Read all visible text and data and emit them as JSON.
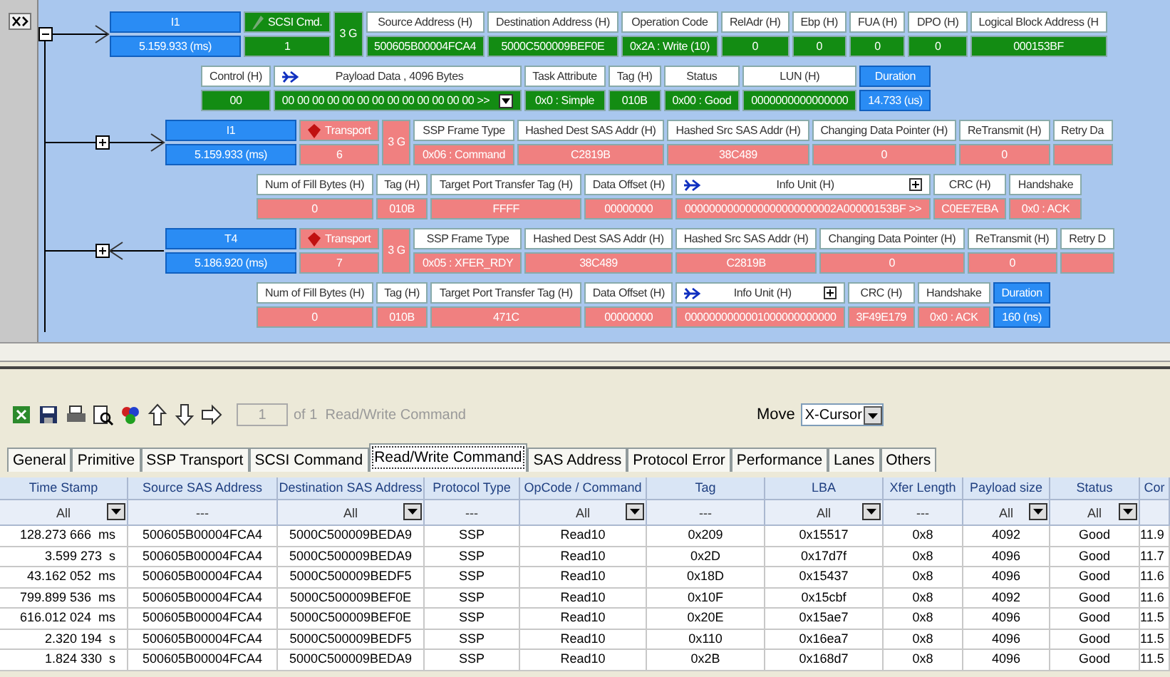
{
  "frames": [
    {
      "kind": "command",
      "color": "#138c13",
      "expanded": true,
      "id": {
        "kind": "initiator",
        "label": "I1",
        "time": "5.159.933 (ms)"
      },
      "type": {
        "label": "SCSI Cmd.",
        "value": "1"
      },
      "speed": "3 G",
      "fields": [
        {
          "label": "Source Address (H)",
          "value": "500605B00004FCA4"
        },
        {
          "label": "Destination Address (H)",
          "value": "5000C500009BEF0E"
        },
        {
          "label": "Operation Code",
          "value": "0x2A : Write (10)"
        },
        {
          "label": "RelAdr (H)",
          "value": "0"
        },
        {
          "label": "Ebp (H)",
          "value": "0"
        },
        {
          "label": "FUA (H)",
          "value": "0"
        },
        {
          "label": "DPO (H)",
          "value": "0"
        },
        {
          "label": "Logical Block Address (H",
          "value": "000153BF"
        }
      ],
      "detail": [
        {
          "kind": "field",
          "label": "Control (H)",
          "value": "00"
        },
        {
          "kind": "payload",
          "label": "Payload Data , 4096 Bytes",
          "value": "00 00 00 00 00 00 00 00 00 00 00 00 00 >>"
        },
        {
          "kind": "field",
          "label": "Task Attribute",
          "value": "0x0 : Simple"
        },
        {
          "kind": "field",
          "label": "Tag (H)",
          "value": "010B"
        },
        {
          "kind": "field",
          "label": "Status",
          "value": "0x00 : Good"
        },
        {
          "kind": "field",
          "label": "LUN (H)",
          "value": "0000000000000000"
        },
        {
          "kind": "duration",
          "label": "Duration",
          "value": "14.733 (us)"
        }
      ],
      "children": [
        {
          "kind": "transport",
          "color": "#f08080",
          "expanded": false,
          "id": {
            "kind": "initiator",
            "label": "I1",
            "time": "5.159.933 (ms)"
          },
          "type": {
            "label": "Transport",
            "value": "6"
          },
          "speed": "3 G",
          "fields": [
            {
              "label": "SSP Frame Type",
              "value": "0x06 : Command"
            },
            {
              "label": "Hashed Dest SAS Addr (H)",
              "value": "C2819B"
            },
            {
              "label": "Hashed Src SAS Addr (H)",
              "value": "38C489"
            },
            {
              "label": "Changing Data Pointer (H)",
              "value": "0"
            },
            {
              "label": "ReTransmit (H)",
              "value": "0"
            },
            {
              "label": "Retry Da"
            }
          ],
          "detail": [
            {
              "kind": "field",
              "label": "Num of Fill Bytes (H)",
              "value": "0"
            },
            {
              "kind": "field",
              "label": "Tag (H)",
              "value": "010B"
            },
            {
              "kind": "field",
              "label": "Target Port Transfer Tag (H)",
              "value": "FFFF"
            },
            {
              "kind": "field",
              "label": "Data Offset (H)",
              "value": "00000000"
            },
            {
              "kind": "info-unit",
              "label": "Info Unit (H)",
              "value": "0000000000000000000000002A00000153BF >>"
            },
            {
              "kind": "field",
              "label": "CRC (H)",
              "value": "C0EE7EBA"
            },
            {
              "kind": "field",
              "label": "Handshake",
              "value": "0x0 : ACK"
            }
          ]
        },
        {
          "kind": "transport",
          "color": "#f08080",
          "expanded": false,
          "id": {
            "kind": "target",
            "label": "T4",
            "time": "5.186.920 (ms)"
          },
          "type": {
            "label": "Transport",
            "value": "7"
          },
          "speed": "3 G",
          "fields": [
            {
              "label": "SSP Frame Type",
              "value": "0x05 : XFER_RDY"
            },
            {
              "label": "Hashed Dest SAS Addr (H)",
              "value": "38C489"
            },
            {
              "label": "Hashed Src SAS Addr (H)",
              "value": "C2819B"
            },
            {
              "label": "Changing Data Pointer (H)",
              "value": "0"
            },
            {
              "label": "ReTransmit (H)",
              "value": "0"
            },
            {
              "label": "Retry D"
            }
          ],
          "detail": [
            {
              "kind": "field",
              "label": "Num of Fill Bytes (H)",
              "value": "0"
            },
            {
              "kind": "field",
              "label": "Tag (H)",
              "value": "010B"
            },
            {
              "kind": "field",
              "label": "Target Port Transfer Tag (H)",
              "value": "471C"
            },
            {
              "kind": "field",
              "label": "Data Offset (H)",
              "value": "00000000"
            },
            {
              "kind": "info-unit",
              "label": "Info Unit (H)",
              "value": "0000000000001000000000000"
            },
            {
              "kind": "field",
              "label": "CRC (H)",
              "value": "3F49E179"
            },
            {
              "kind": "field",
              "label": "Handshake",
              "value": "0x0 : ACK"
            },
            {
              "kind": "duration",
              "label": "Duration",
              "value": "160 (ns)"
            }
          ]
        }
      ]
    }
  ],
  "toolbar": {
    "page_field": {
      "value": "1",
      "disabled": true
    },
    "page_info": "of 1  Read/Write Command",
    "move_label": "Move",
    "move_value": "X-Cursor"
  },
  "tabs": [
    {
      "label": "General",
      "selected": false
    },
    {
      "label": "Primitive",
      "selected": false
    },
    {
      "label": "SSP Transport",
      "selected": false
    },
    {
      "label": "SCSI Command",
      "selected": false
    },
    {
      "label": "Read/Write Command",
      "selected": true
    },
    {
      "label": "SAS Address",
      "selected": false
    },
    {
      "label": "Protocol Error",
      "selected": false
    },
    {
      "label": "Performance",
      "selected": false
    },
    {
      "label": "Lanes",
      "selected": false
    },
    {
      "label": "Others",
      "selected": false
    }
  ],
  "table": {
    "columns": [
      {
        "label": "Time Stamp",
        "filter": {
          "kind": "dropdown",
          "value": "All"
        }
      },
      {
        "label": "Source SAS Address",
        "filter": {
          "kind": "text",
          "value": "---"
        }
      },
      {
        "label": "Destination SAS Address",
        "filter": {
          "kind": "dropdown",
          "value": "All"
        }
      },
      {
        "label": "Protocol Type",
        "filter": {
          "kind": "text",
          "value": "---"
        }
      },
      {
        "label": "OpCode / Command",
        "filter": {
          "kind": "dropdown",
          "value": "All"
        }
      },
      {
        "label": "Tag",
        "filter": {
          "kind": "text",
          "value": "---"
        }
      },
      {
        "label": "LBA",
        "filter": {
          "kind": "dropdown",
          "value": "All"
        }
      },
      {
        "label": "Xfer Length",
        "filter": {
          "kind": "text",
          "value": "---"
        }
      },
      {
        "label": "Payload size",
        "filter": {
          "kind": "dropdown",
          "value": "All"
        }
      },
      {
        "label": "Status",
        "filter": {
          "kind": "dropdown",
          "value": "All"
        }
      },
      {
        "label": "Cor"
      }
    ],
    "rows": [
      {
        "cells": [
          "128.273 666  ms",
          "500605B00004FCA4",
          "5000C500009BEDA9",
          "SSP",
          "Read10",
          "0x209",
          "0x15517",
          "0x8",
          "4092",
          "Good",
          "11.9"
        ]
      },
      {
        "cells": [
          "3.599 273  s",
          "500605B00004FCA4",
          "5000C500009BEDA9",
          "SSP",
          "Read10",
          "0x2D",
          "0x17d7f",
          "0x8",
          "4096",
          "Good",
          "11.7"
        ]
      },
      {
        "cells": [
          "43.162 052  ms",
          "500605B00004FCA4",
          "5000C500009BEDF5",
          "SSP",
          "Read10",
          "0x18D",
          "0x15437",
          "0x8",
          "4096",
          "Good",
          "11.6"
        ]
      },
      {
        "cells": [
          "799.899 536  ms",
          "500605B00004FCA4",
          "5000C500009BEF0E",
          "SSP",
          "Read10",
          "0x10F",
          "0x15cbf",
          "0x8",
          "4092",
          "Good",
          "11.6"
        ]
      },
      {
        "cells": [
          "616.012 024  ms",
          "500605B00004FCA4",
          "5000C500009BEF0E",
          "SSP",
          "Read10",
          "0x20E",
          "0x15ae7",
          "0x8",
          "4096",
          "Good",
          "11.5"
        ]
      },
      {
        "cells": [
          "2.320 194  s",
          "500605B00004FCA4",
          "5000C500009BEDF5",
          "SSP",
          "Read10",
          "0x110",
          "0x16ea7",
          "0x8",
          "4096",
          "Good",
          "11.5"
        ]
      },
      {
        "cells": [
          "1.824 330  s",
          "500605B00004FCA4",
          "5000C500009BEDA9",
          "SSP",
          "Read10",
          "0x2B",
          "0x168d7",
          "0x8",
          "4096",
          "Good",
          "11.5"
        ]
      }
    ]
  }
}
